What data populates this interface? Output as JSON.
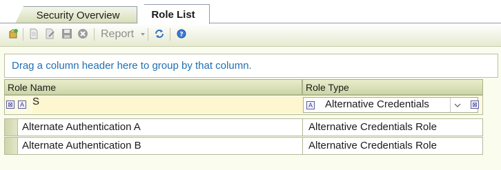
{
  "tabs": [
    {
      "label": "Security Overview",
      "active": false
    },
    {
      "label": "Role List",
      "active": true
    }
  ],
  "toolbar": {
    "report_label": "Report",
    "icons": [
      "new-role-icon",
      "document-icon",
      "edit-icon",
      "save-icon",
      "delete-icon",
      "refresh-icon",
      "help-icon"
    ]
  },
  "group_panel": {
    "text": "Drag a column header here to group by that column."
  },
  "grid": {
    "columns": [
      "Role Name",
      "Role Type"
    ],
    "filter": {
      "role_name_value": "S",
      "role_type_value": "Alternative Credentials"
    },
    "rows": [
      {
        "role_name": "Alternate Authentication A",
        "role_type": "Alternative Credentials Role"
      },
      {
        "role_name": "Alternate Authentication B",
        "role_type": "Alternative Credentials Role"
      }
    ]
  },
  "colors": {
    "accent": "#1f6fb2",
    "header": "#cdd4a6",
    "filter_bg": "#fdfbdf"
  }
}
